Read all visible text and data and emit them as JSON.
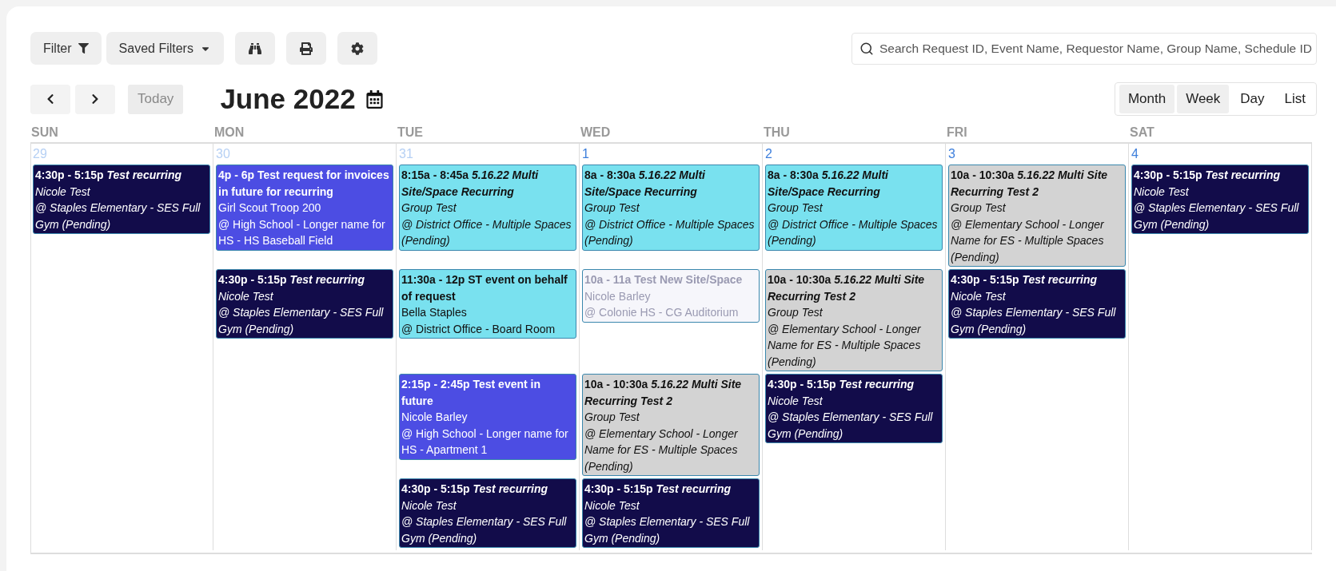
{
  "toolbar": {
    "buttons": [
      {
        "kind": "filter",
        "label": "Filter"
      },
      {
        "kind": "dropdown",
        "label": "Saved Filters"
      },
      {
        "kind": "binoculars"
      },
      {
        "kind": "print"
      },
      {
        "kind": "settings"
      }
    ],
    "search": {
      "placeholder": "Search Request ID, Event Name, Requestor Name, Group Name, Schedule ID"
    }
  },
  "navigation": {
    "today": {
      "label": "Today",
      "disabled": true
    },
    "title": "June 2022"
  },
  "views": [
    {
      "label": "Month",
      "selected": true
    },
    {
      "label": "Week",
      "selected": true
    },
    {
      "label": "Day",
      "selected": false
    },
    {
      "label": "List",
      "selected": false
    }
  ],
  "days": [
    {
      "name": "SUN",
      "date": "29",
      "other_month": true,
      "events": [
        {
          "time": "4:30p - 5:15p",
          "title": "Test recurring",
          "requester": "Nicole Test",
          "location": "@ Staples Elementary - SES Full Gym (Pending)",
          "color": "#120c4a",
          "italic": true,
          "faded": false
        }
      ]
    },
    {
      "name": "MON",
      "date": "30",
      "other_month": true,
      "events": [
        {
          "time": "4p - 6p",
          "title": "Test request for invoices in future for recurring",
          "requester": "Girl Scout Troop 200",
          "location": "@ High School - Longer name for HS - HS Baseball Field",
          "color": "#4c4de3",
          "italic": false,
          "faded": false
        },
        {
          "time": "4:30p - 5:15p",
          "title": "Test recurring",
          "requester": "Nicole Test",
          "location": "@ Staples Elementary - SES Full Gym (Pending)",
          "color": "#120c4a",
          "italic": true,
          "faded": false
        }
      ]
    },
    {
      "name": "TUE",
      "date": "31",
      "other_month": true,
      "events": [
        {
          "time": "8:15a - 8:45a",
          "title": "5.16.22 Multi Site/Space Recurring",
          "requester": "Group Test",
          "location": "@ District Office - Multiple Spaces (Pending)",
          "color": "#79e1ef",
          "italic": true,
          "faded": false
        },
        {
          "time": "11:30a - 12p",
          "title": "ST event on behalf of request",
          "requester": "Bella Staples",
          "location": "@ District Office - Board Room",
          "color": "#79e1ef",
          "italic": false,
          "faded": false
        },
        {
          "time": "2:15p - 2:45p",
          "title": "Test event in future",
          "requester": "Nicole Barley",
          "location": "@ High School - Longer name for HS - Apartment 1",
          "color": "#4c4de3",
          "italic": false,
          "faded": false
        },
        {
          "time": "4:30p - 5:15p",
          "title": "Test recurring",
          "requester": "Nicole Test",
          "location": "@ Staples Elementary - SES Full Gym (Pending)",
          "color": "#120c4a",
          "italic": true,
          "faded": false
        }
      ]
    },
    {
      "name": "WED",
      "date": "1",
      "other_month": false,
      "events": [
        {
          "time": "8a - 8:30a",
          "title": "5.16.22 Multi Site/Space Recurring",
          "requester": "Group Test",
          "location": "@ District Office - Multiple Spaces (Pending)",
          "color": "#79e1ef",
          "italic": true,
          "faded": false
        },
        {
          "time": "10a - 11a",
          "title": "Test New Site/Space",
          "requester": "Nicole Barley",
          "location": "@ Colonie HS - CG Auditorium",
          "color": "#f6f6fb",
          "italic": false,
          "faded": true
        },
        {
          "time": "10a - 10:30a",
          "title": "5.16.22 Multi Site Recurring Test 2",
          "requester": "Group Test",
          "location": "@ Elementary School - Longer Name for ES - Multiple Spaces (Pending)",
          "color": "#d3d3d3",
          "italic": true,
          "faded": false
        },
        {
          "time": "4:30p - 5:15p",
          "title": "Test recurring",
          "requester": "Nicole Test",
          "location": "@ Staples Elementary - SES Full Gym (Pending)",
          "color": "#120c4a",
          "italic": true,
          "faded": false
        }
      ]
    },
    {
      "name": "THU",
      "date": "2",
      "other_month": false,
      "events": [
        {
          "time": "8a - 8:30a",
          "title": "5.16.22 Multi Site/Space Recurring",
          "requester": "Group Test",
          "location": "@ District Office - Multiple Spaces (Pending)",
          "color": "#79e1ef",
          "italic": true,
          "faded": false
        },
        {
          "time": "10a - 10:30a",
          "title": "5.16.22 Multi Site Recurring Test 2",
          "requester": "Group Test",
          "location": "@ Elementary School - Longer Name for ES - Multiple Spaces (Pending)",
          "color": "#d3d3d3",
          "italic": true,
          "faded": false
        },
        {
          "time": "4:30p - 5:15p",
          "title": "Test recurring",
          "requester": "Nicole Test",
          "location": "@ Staples Elementary - SES Full Gym (Pending)",
          "color": "#120c4a",
          "italic": true,
          "faded": false
        }
      ]
    },
    {
      "name": "FRI",
      "date": "3",
      "other_month": false,
      "events": [
        {
          "time": "10a - 10:30a",
          "title": "5.16.22 Multi Site Recurring Test 2",
          "requester": "Group Test",
          "location": "@ Elementary School - Longer Name for ES - Multiple Spaces (Pending)",
          "color": "#d3d3d3",
          "italic": true,
          "faded": false
        },
        {
          "time": "4:30p - 5:15p",
          "title": "Test recurring",
          "requester": "Nicole Test",
          "location": "@ Staples Elementary - SES Full Gym (Pending)",
          "color": "#120c4a",
          "italic": true,
          "faded": false
        }
      ]
    },
    {
      "name": "SAT",
      "date": "4",
      "other_month": false,
      "events": [
        {
          "time": "4:30p - 5:15p",
          "title": "Test recurring",
          "requester": "Nicole Test",
          "location": "@ Staples Elementary - SES Full Gym (Pending)",
          "color": "#120c4a",
          "italic": true,
          "faded": false
        }
      ]
    }
  ]
}
